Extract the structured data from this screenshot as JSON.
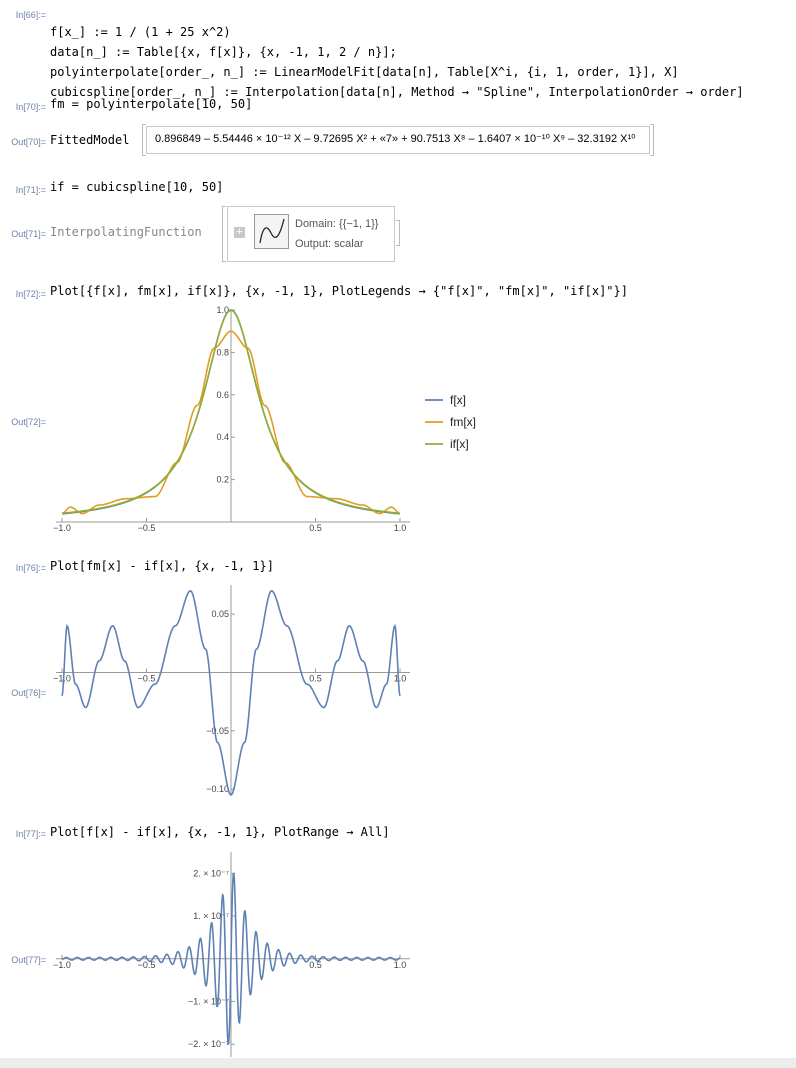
{
  "cells": [
    {
      "in_label": "In[66]:=",
      "lines": [
        "f[x_] := 1 / (1 + 25 x^2)",
        "data[n_] := Table[{x, f[x]}, {x, -1, 1, 2 / n}];",
        "polyinterpolate[order_, n_] := LinearModelFit[data[n], Table[X^i, {i, 1, order, 1}], X]",
        "cubicspline[order_, n_] := Interpolation[data[n], Method → \"Spline\", InterpolationOrder → order]"
      ]
    },
    {
      "in_label": "In[70]:=",
      "code": "fm = polyinterpolate[10, 50]",
      "out_label": "Out[70]=",
      "out_head": "FittedModel",
      "out_value": "0.896849 – 5.54446 × 10⁻¹² X – 9.72695 X² + «7» + 90.7513 X⁸ – 1.6407 × 10⁻¹⁰ X⁹ – 32.3192 X¹⁰"
    },
    {
      "in_label": "In[71]:=",
      "code": "if = cubicspline[10, 50]",
      "out_label": "Out[71]=",
      "out_head": "InterpolatingFunction",
      "domain": "Domain: {{−1, 1}}",
      "output": "Output: scalar"
    },
    {
      "in_label": "In[72]:=",
      "code": "Plot[{f[x], fm[x], if[x]}, {x, -1, 1}, PlotLegends → {\"f[x]\", \"fm[x]\", \"if[x]\"}]",
      "out_label": "Out[72]="
    },
    {
      "in_label": "In[76]:=",
      "code": "Plot[fm[x] - if[x], {x, -1, 1}]",
      "out_label": "Out[76]="
    },
    {
      "in_label": "In[77]:=",
      "code": "Plot[f[x] - if[x], {x, -1, 1}, PlotRange → All]",
      "out_label": "Out[77]="
    }
  ],
  "chart_data": [
    {
      "type": "line",
      "xlim": [
        -1,
        1
      ],
      "ylim": [
        0,
        1.0
      ],
      "xticks": [
        "−1.0",
        "−0.5",
        "0.5",
        "1.0"
      ],
      "xtick_values": [
        -1,
        -0.5,
        0.5,
        1
      ],
      "yticks": [
        "0.2",
        "0.4",
        "0.6",
        "0.8",
        "1.0"
      ],
      "ytick_values": [
        0.2,
        0.4,
        0.6,
        0.8,
        1.0
      ],
      "series": [
        {
          "name": "f[x]",
          "color": "#5e81b5",
          "values_note": "1/(1+25x^2)"
        },
        {
          "name": "fm[x]",
          "color": "#e19c24",
          "values": [
            [
              -1,
              0.04
            ],
            [
              -0.95,
              0.07
            ],
            [
              -0.88,
              0.04
            ],
            [
              -0.78,
              0.08
            ],
            [
              -0.62,
              0.11
            ],
            [
              -0.45,
              0.12
            ],
            [
              -0.32,
              0.28
            ],
            [
              -0.2,
              0.55
            ],
            [
              -0.1,
              0.82
            ],
            [
              0,
              0.9
            ],
            [
              0.1,
              0.82
            ],
            [
              0.2,
              0.55
            ],
            [
              0.32,
              0.28
            ],
            [
              0.45,
              0.12
            ],
            [
              0.62,
              0.11
            ],
            [
              0.78,
              0.08
            ],
            [
              0.88,
              0.04
            ],
            [
              0.95,
              0.07
            ],
            [
              1,
              0.04
            ]
          ]
        },
        {
          "name": "if[x]",
          "color": "#8fb032",
          "values_note": "spline ≈ f[x]"
        }
      ],
      "legend": "right"
    },
    {
      "type": "line",
      "xlim": [
        -1,
        1
      ],
      "ylim": [
        -0.1,
        0.07
      ],
      "xticks": [
        "−1.0",
        "−0.5",
        "0.5",
        "1.0"
      ],
      "xtick_values": [
        -1,
        -0.5,
        0.5,
        1
      ],
      "yticks": [
        "0.05",
        "−0.05",
        "−0.10"
      ],
      "ytick_values": [
        0.05,
        -0.05,
        -0.1
      ],
      "series": [
        {
          "color": "#5e81b5",
          "values": [
            [
              -1,
              -0.02
            ],
            [
              -0.97,
              0.04
            ],
            [
              -0.92,
              -0.01
            ],
            [
              -0.86,
              -0.03
            ],
            [
              -0.78,
              0.01
            ],
            [
              -0.7,
              0.04
            ],
            [
              -0.63,
              0.01
            ],
            [
              -0.55,
              -0.03
            ],
            [
              -0.45,
              -0.01
            ],
            [
              -0.33,
              0.04
            ],
            [
              -0.24,
              0.07
            ],
            [
              -0.15,
              0.02
            ],
            [
              -0.08,
              -0.06
            ],
            [
              0,
              -0.105
            ],
            [
              0.08,
              -0.06
            ],
            [
              0.15,
              0.02
            ],
            [
              0.24,
              0.07
            ],
            [
              0.33,
              0.04
            ],
            [
              0.45,
              -0.01
            ],
            [
              0.55,
              -0.03
            ],
            [
              0.63,
              0.01
            ],
            [
              0.7,
              0.04
            ],
            [
              0.78,
              0.01
            ],
            [
              0.86,
              -0.03
            ],
            [
              0.92,
              -0.01
            ],
            [
              0.97,
              0.04
            ],
            [
              1,
              -0.02
            ]
          ]
        }
      ]
    },
    {
      "type": "line",
      "xlim": [
        -1,
        1
      ],
      "ylim": [
        -2.2e-07,
        2.5e-07
      ],
      "xticks": [
        "−1.0",
        "−0.5",
        "0.5",
        "1.0"
      ],
      "xtick_values": [
        -1,
        -0.5,
        0.5,
        1
      ],
      "yticks": [
        "2. × 10⁻⁷",
        "1. × 10⁻⁷",
        "−1. × 10⁻⁷",
        "−2. × 10⁻⁷"
      ],
      "ytick_values": [
        2e-07,
        1e-07,
        -1e-07,
        -2e-07
      ],
      "series": [
        {
          "color": "#5e81b5",
          "values_note": "oscillating error growing toward 0"
        }
      ]
    }
  ]
}
